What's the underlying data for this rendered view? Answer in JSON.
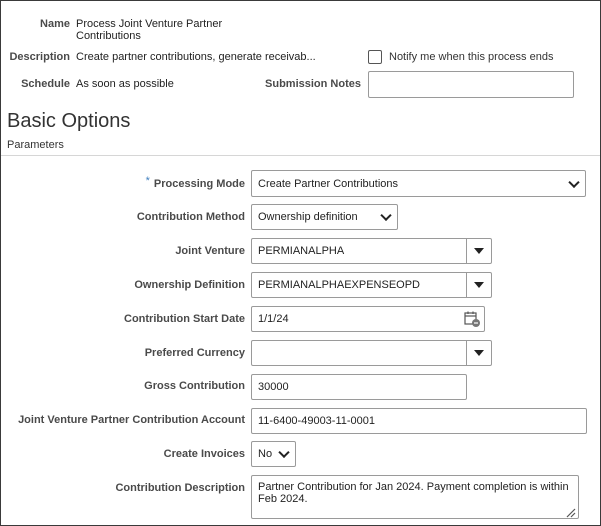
{
  "header": {
    "name_label": "Name",
    "name_value_line1": "Process Joint Venture Partner",
    "name_value_line2": "Contributions",
    "description_label": "Description",
    "description_value": "Create partner contributions, generate receivab...",
    "notify_label": "Notify me when this process ends",
    "notify_checked": false,
    "schedule_label": "Schedule",
    "schedule_value": "As soon as possible",
    "submission_notes_label": "Submission Notes",
    "submission_notes_value": ""
  },
  "section": {
    "title": "Basic Options",
    "subtitle": "Parameters"
  },
  "params": {
    "required_mark": "*",
    "processing_mode_label": "Processing Mode",
    "processing_mode_value": "Create Partner Contributions",
    "contribution_method_label": "Contribution Method",
    "contribution_method_value": "Ownership definition",
    "joint_venture_label": "Joint Venture",
    "joint_venture_value": "PERMIANALPHA",
    "ownership_definition_label": "Ownership Definition",
    "ownership_definition_value": "PERMIANALPHAEXPENSEOPD",
    "contribution_start_date_label": "Contribution Start Date",
    "contribution_start_date_value": "1/1/24",
    "preferred_currency_label": "Preferred Currency",
    "preferred_currency_value": "",
    "gross_contribution_label": "Gross Contribution",
    "gross_contribution_value": "30000",
    "account_label": "Joint Venture Partner Contribution Account",
    "account_value": "11-6400-49003-11-0001",
    "create_invoices_label": "Create Invoices",
    "create_invoices_value": "No",
    "contribution_description_label": "Contribution Description",
    "contribution_description_line1": "Partner Contribution for Jan 2024. Payment completion is within",
    "contribution_description_line2": "Feb 2024."
  }
}
